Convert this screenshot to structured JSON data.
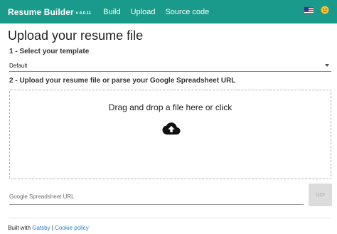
{
  "appbar": {
    "brand_title": "Resume Builder",
    "brand_version": "v 4.0.11",
    "nav": [
      "Build",
      "Upload",
      "Source code"
    ],
    "icons": [
      "us-flag-icon",
      "smiley-icon"
    ],
    "background_color": "#1a9a8a"
  },
  "main": {
    "title": "Upload your resume file",
    "step1_label": "1 - Select your template",
    "template_selected": "Default",
    "step2_label": "2 - Upload your resume file or parse your Google Spreadsheet URL",
    "dropzone_text": "Drag and drop a file here or click",
    "dropzone_icon": "cloud-upload-icon",
    "spreadsheet_placeholder": "Google Spreadsheet URL",
    "spreadsheet_value": "",
    "go_button": "GO!"
  },
  "footer": {
    "built_with": "Built with",
    "gatsby_link": "Gatsby",
    "separator": "|",
    "cookie_link": "Cookie policy",
    "link_color": "#1e7fd1"
  }
}
